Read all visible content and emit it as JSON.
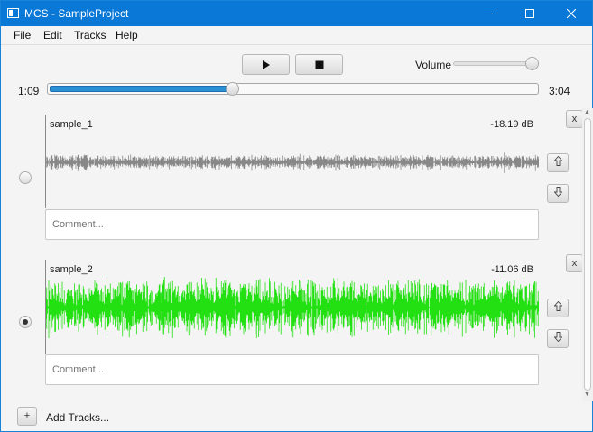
{
  "window": {
    "title": "MCS - SampleProject",
    "controls": {
      "minimize": "minimize-icon",
      "maximize": "maximize-icon",
      "close": "close-icon"
    }
  },
  "menu": {
    "items": [
      "File",
      "Edit",
      "Tracks",
      "Help"
    ]
  },
  "transport": {
    "play_icon": "play-icon",
    "stop_icon": "stop-icon",
    "volume_label": "Volume",
    "volume_level": 0.93
  },
  "progress": {
    "current_time": "1:09",
    "total_time": "3:04",
    "fraction": 0.375
  },
  "tracks": [
    {
      "name": "sample_1",
      "level_db": "-18.19 dB",
      "selected": false,
      "waveform_color": "#888888",
      "waveform_amplitude": 0.25,
      "comment_placeholder": "Comment...",
      "remove_label": "x",
      "move_up_icon": "arrow-up-icon",
      "move_down_icon": "arrow-down-icon"
    },
    {
      "name": "sample_2",
      "level_db": "-11.06 dB",
      "selected": true,
      "waveform_color": "#22e011",
      "waveform_amplitude": 1.0,
      "comment_placeholder": "Comment...",
      "remove_label": "x",
      "move_up_icon": "arrow-up-icon",
      "move_down_icon": "arrow-down-icon"
    }
  ],
  "footer": {
    "add_button": "+",
    "add_label": "Add Tracks..."
  },
  "colors": {
    "titlebar": "#0a78d7",
    "progress_fill": "#2b8fd4",
    "accent_green": "#22e011"
  }
}
